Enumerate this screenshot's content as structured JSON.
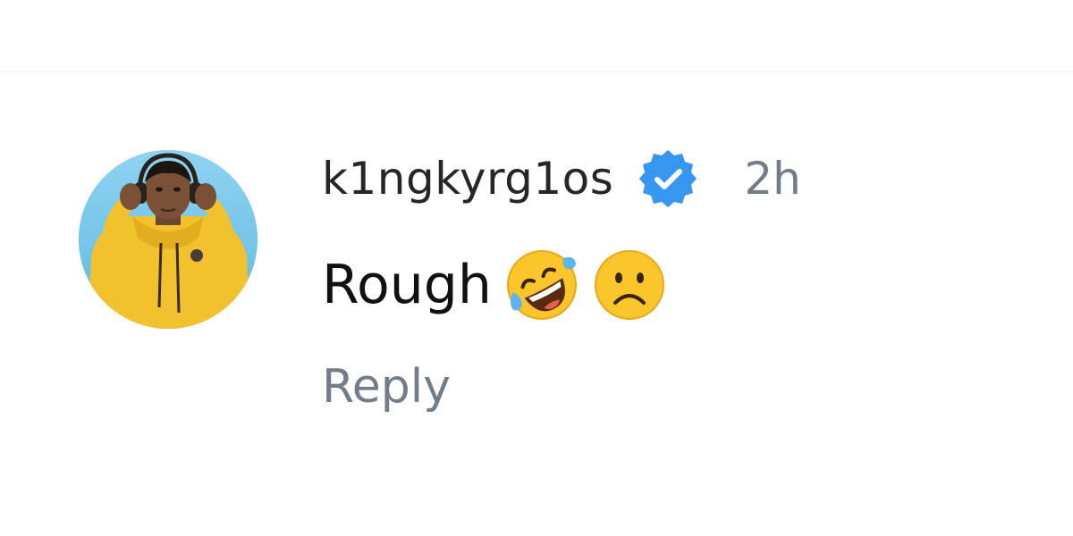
{
  "comment": {
    "username": "k1ngkyrg1os",
    "verified": true,
    "verified_color": "#3797f0",
    "timestamp": "2h",
    "text": "Rough",
    "emojis": [
      "rolling-on-floor-laughing-emoji",
      "frowning-face-emoji"
    ],
    "reply_label": "Reply"
  },
  "colors": {
    "background": "#ffffff",
    "username": "#262626",
    "muted": "#737d8a",
    "avatar_bg": "#7fc9ea",
    "hoodie": "#f2c12e"
  }
}
